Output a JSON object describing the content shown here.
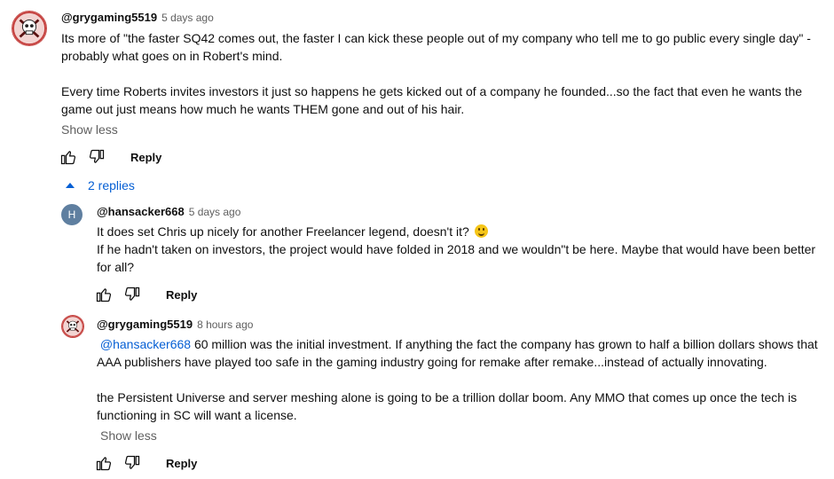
{
  "comment": {
    "handle": "@grygaming5519",
    "time": "5 days ago",
    "paragraphs": [
      "Its more of \"the faster SQ42 comes out, the faster I can kick these people out of my company who tell me to go public every single day\" - probably what goes on in Robert's mind.",
      "Every time Roberts invites investors it just so happens he gets kicked out of a company he founded...so the fact that even he wants the game out just means how much he wants THEM gone and out of his hair."
    ],
    "show_less": "Show less",
    "reply_label": "Reply",
    "replies_toggle": "2 replies"
  },
  "replies": [
    {
      "handle": "@hansacker668",
      "time": "5 days ago",
      "avatar_letter": "H",
      "line1": "It does set Chris up nicely for another Freelancer legend, doesn't it?",
      "emoji": "smiling-face-emoji",
      "line2": "If he hadn't taken on investors, the project would have folded in 2018 and we wouldn\"t be here. Maybe that would have been better for all?",
      "reply_label": "Reply"
    },
    {
      "handle": "@grygaming5519",
      "time": "8 hours ago",
      "mention": "@hansacker668",
      "para1": " 60 million was the initial investment. If anything the fact the company has grown to half a billion dollars shows that AAA publishers have played too safe in the gaming industry going for remake after remake...instead of actually innovating.",
      "para2": "the Persistent Universe and server meshing alone is going to be a trillion dollar boom. Any MMO that comes up once the tech is functioning in SC will want a license.",
      "show_less": "Show less",
      "reply_label": "Reply"
    }
  ],
  "colors": {
    "link": "#065fd4",
    "secondary_text": "#606060",
    "text": "#0f0f0f"
  }
}
